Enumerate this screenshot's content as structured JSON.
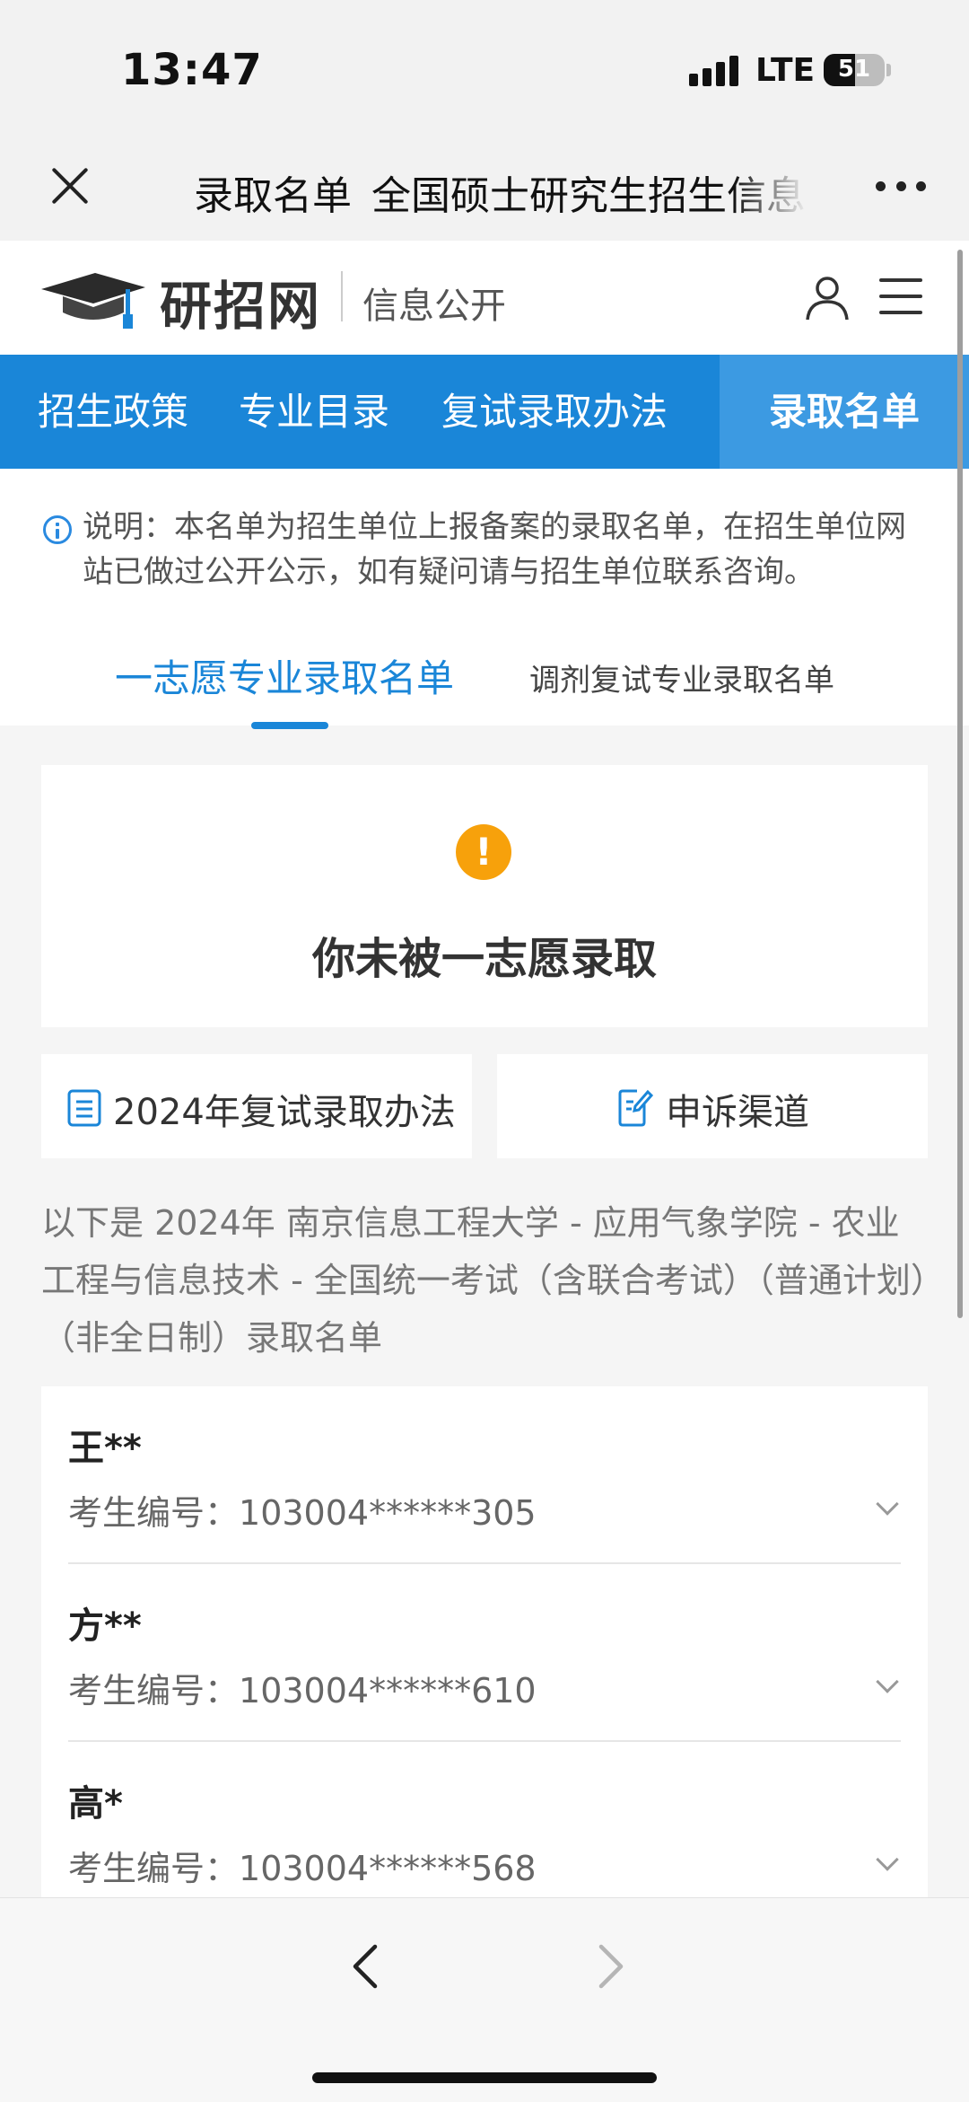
{
  "status_bar": {
    "time": "13:47",
    "network": "LTE",
    "battery_level": "51",
    "battery_fraction": 0.51,
    "signal_icon": "cellular-signal-icon"
  },
  "browser": {
    "page_title": "录取名单_全国硕士研究生招生信息公开平台",
    "close_icon": "close-icon",
    "more_icon": "more-dots-icon",
    "back_icon": "chevron-left-icon",
    "forward_icon": "chevron-right-icon"
  },
  "site": {
    "logo_text": "研招网",
    "logo_sub": "信息公开",
    "user_icon": "user-icon",
    "menu_icon": "hamburger-menu-icon",
    "brand_color": "#1a86d8"
  },
  "nav": {
    "items": [
      {
        "label": "招生政策"
      },
      {
        "label": "专业目录"
      },
      {
        "label": "复试录取办法"
      },
      {
        "label": "录取名单"
      }
    ],
    "active": "录取名单"
  },
  "notice": {
    "text": "说明：本名单为招生单位上报备案的录取名单，在招生单位网站已做过公开公示，如有疑问请与招生单位联系咨询。"
  },
  "tabs": {
    "first_choice": "一志愿专业录取名单",
    "adjustment": "调剂复试专业录取名单"
  },
  "result": {
    "icon": "!",
    "message": "你未被一志愿录取",
    "warn_color": "#f7a10b"
  },
  "links": {
    "rules_label": "2024年复试录取办法",
    "appeal_label": "申诉渠道"
  },
  "description": "以下是 2024年 南京信息工程大学 - 应用气象学院 - 农业工程与信息技术 - 全国统一考试（含联合考试）（普通计划）（非全日制）录取名单",
  "admitted": {
    "id_label": "考生编号：",
    "list": [
      {
        "name": "王**",
        "id": "103004******305"
      },
      {
        "name": "方**",
        "id": "103004******610"
      },
      {
        "name": "高*",
        "id": "103004******568"
      }
    ]
  }
}
